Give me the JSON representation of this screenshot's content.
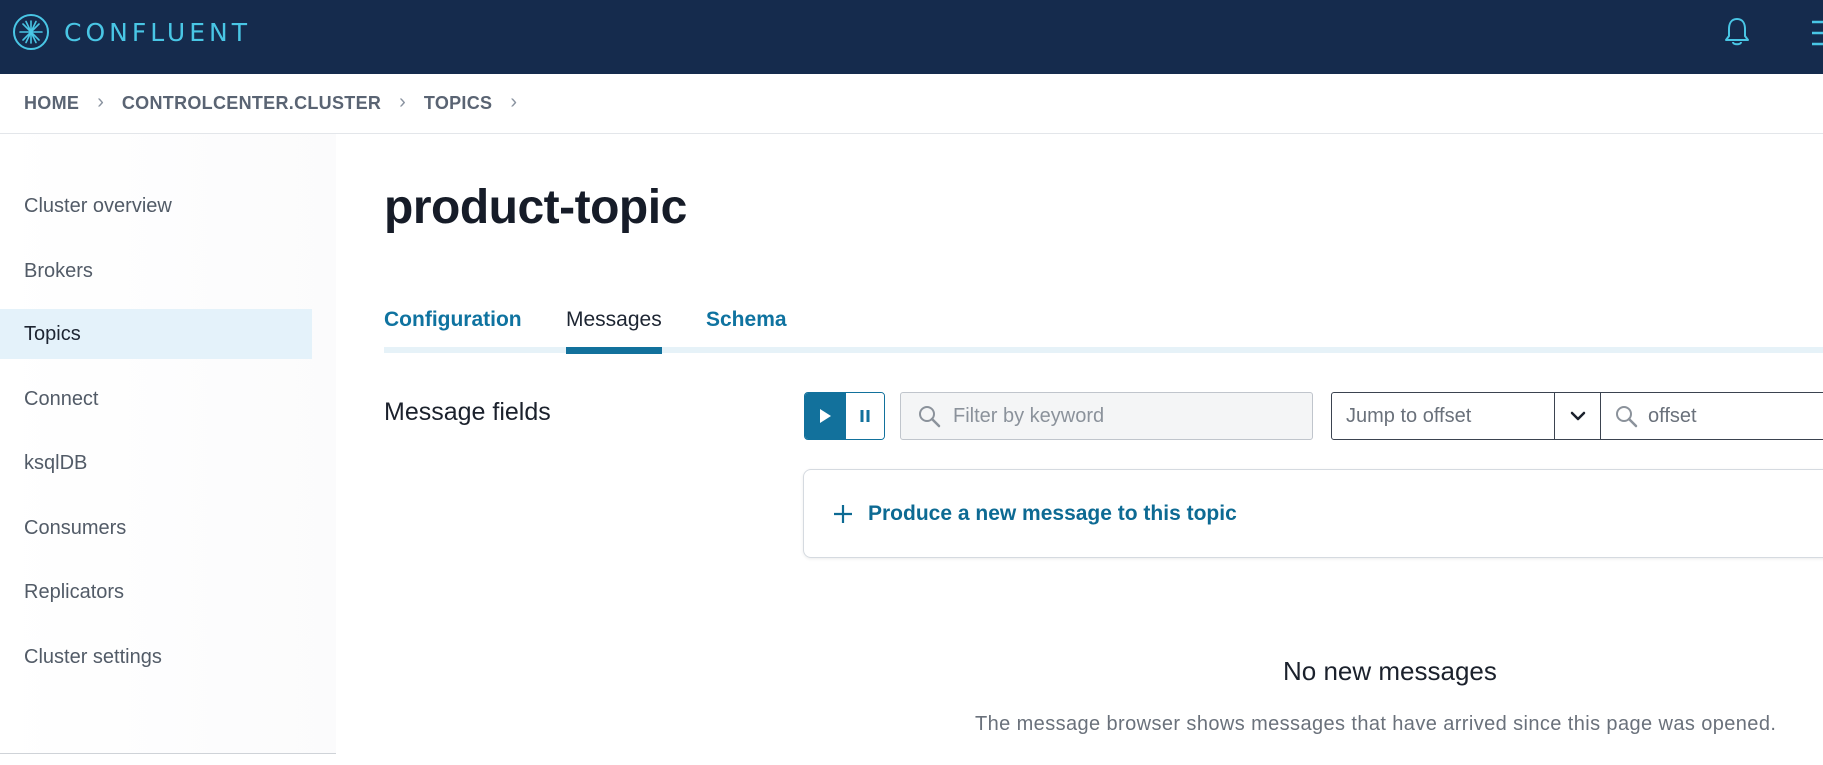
{
  "header": {
    "brand": "CONFLUENT",
    "icons": {
      "logo": "confluent-logo-icon",
      "notifications": "bell-icon",
      "menu": "hamburger-menu-icon"
    },
    "colors": {
      "background": "#152b4d",
      "accent": "#49c6e5"
    }
  },
  "breadcrumb": {
    "items": [
      "HOME",
      "CONTROLCENTER.CLUSTER",
      "TOPICS"
    ],
    "separator": "›"
  },
  "sidebar": {
    "items": [
      {
        "label": "Cluster overview",
        "active": false
      },
      {
        "label": "Brokers",
        "active": false
      },
      {
        "label": "Topics",
        "active": true
      },
      {
        "label": "Connect",
        "active": false
      },
      {
        "label": "ksqlDB",
        "active": false
      },
      {
        "label": "Consumers",
        "active": false
      },
      {
        "label": "Replicators",
        "active": false
      },
      {
        "label": "Cluster settings",
        "active": false
      }
    ]
  },
  "main": {
    "title": "product-topic",
    "tabs": [
      {
        "label": "Configuration",
        "active": false
      },
      {
        "label": "Messages",
        "active": true
      },
      {
        "label": "Schema",
        "active": false
      }
    ],
    "message_fields_title": "Message fields",
    "controls": {
      "play_icon": "play-icon",
      "pause_icon": "pause-icon",
      "filter_placeholder": "Filter by keyword",
      "jump_label": "Jump to offset",
      "offset_placeholder": "offset"
    },
    "produce_label": "Produce a new message to this topic",
    "empty_title": "No new messages",
    "empty_description": "The message browser shows messages that have arrived since this page was opened.",
    "colors": {
      "primary": "#12719c",
      "link": "#0d6a93"
    }
  }
}
